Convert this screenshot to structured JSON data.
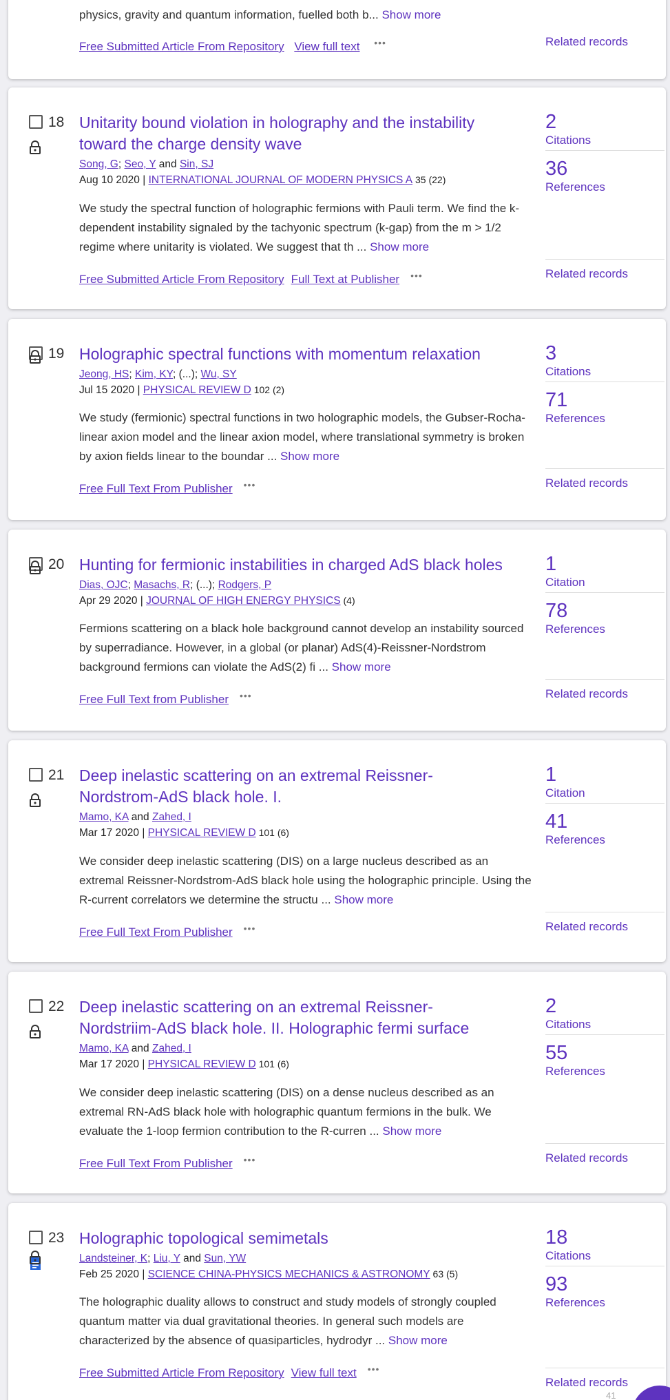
{
  "colors": {
    "accent": "#5e33bf",
    "background": "#efeff3",
    "card": "#ffffff"
  },
  "prev": {
    "abstract_tail": "physics, gravity and quantum information, fuelled both b",
    "links": [
      "Free Submitted Article From Repository",
      "View full text"
    ],
    "related": "Related records"
  },
  "common": {
    "ellipsis": "...",
    "show_more": "Show more",
    "related": "Related records",
    "more_icon": "•••"
  },
  "records": [
    {
      "num": "18",
      "title": "Unitarity bound violation in holography and the instability toward the charge density wave",
      "authors": [
        {
          "name": "Song, G",
          "sep": "; "
        },
        {
          "name": "Seo, Y",
          "sep": " and "
        },
        {
          "name": "Sin, SJ",
          "sep": ""
        }
      ],
      "date": "Aug 10 2020 | ",
      "journal": "INTERNATIONAL JOURNAL OF MODERN PHYSICS A",
      "vol": " 35 (22)",
      "abstract": "We study the spectral function of holographic fermions with Pauli term. We find the k-dependent instability signaled by the tachyonic spectrum (k-gap) from the m > 1/2 regime where unitarity is violated. We suggest that th",
      "links": [
        "Free Submitted Article From Repository",
        "Full Text at Publisher"
      ],
      "citations": "2",
      "citations_label": "Citations",
      "references": "36",
      "references_label": "References"
    },
    {
      "num": "19",
      "title": "Holographic spectral functions with momentum relaxation",
      "authors": [
        {
          "name": "Jeong, HS",
          "sep": "; "
        },
        {
          "name": "Kim, KY",
          "sep": "; (...); "
        },
        {
          "name": "Wu, SY",
          "sep": ""
        }
      ],
      "date": "Jul 15 2020 | ",
      "journal": "PHYSICAL REVIEW D",
      "vol": " 102 (2)",
      "abstract": "We study (fermionic) spectral functions in two holographic models, the Gubser-Rocha-linear axion model and the linear axion model, where translational symmetry is broken by axion fields linear to the boundar",
      "links": [
        "Free Full Text From Publisher"
      ],
      "citations": "3",
      "citations_label": "Citations",
      "references": "71",
      "references_label": "References"
    },
    {
      "num": "20",
      "title": "Hunting for fermionic instabilities in charged AdS black holes",
      "authors": [
        {
          "name": "Dias, OJC",
          "sep": "; "
        },
        {
          "name": "Masachs, R",
          "sep": "; (...); "
        },
        {
          "name": "Rodgers, P",
          "sep": ""
        }
      ],
      "date": "Apr 29 2020 | ",
      "journal": "JOURNAL OF HIGH ENERGY PHYSICS",
      "vol": " (4)",
      "abstract": "Fermions scattering on a black hole background cannot develop an instability sourced by superradiance. However, in a global (or planar) AdS(4)-Reissner-Nordstrom background fermions can violate the AdS(2) fi",
      "links": [
        "Free Full Text from Publisher"
      ],
      "citations": "1",
      "citations_label": "Citation",
      "references": "78",
      "references_label": "References"
    },
    {
      "num": "21",
      "title": "Deep inelastic scattering on an extremal Reissner-Nordstrom-AdS black hole. I.",
      "authors": [
        {
          "name": "Mamo, KA",
          "sep": " and "
        },
        {
          "name": "Zahed, I",
          "sep": ""
        }
      ],
      "date": "Mar 17 2020 | ",
      "journal": "PHYSICAL REVIEW D",
      "vol": " 101 (6)",
      "abstract": "We consider deep inelastic scattering (DIS) on a large nucleus described as an extremal Reissner-Nordstrom-AdS black hole using the holographic principle. Using the R-current correlators we determine the structu",
      "links": [
        "Free Full Text From Publisher"
      ],
      "citations": "1",
      "citations_label": "Citation",
      "references": "41",
      "references_label": "References"
    },
    {
      "num": "22",
      "title": "Deep inelastic scattering on an extremal Reissner-Nordstriim-AdS black hole. II. Holographic fermi surface",
      "authors": [
        {
          "name": "Mamo, KA",
          "sep": " and "
        },
        {
          "name": "Zahed, I",
          "sep": ""
        }
      ],
      "date": "Mar 17 2020 | ",
      "journal": "PHYSICAL REVIEW D",
      "vol": " 101 (6)",
      "abstract": "We consider deep inelastic scattering (DIS) on a dense nucleus described as an extremal RN-AdS black hole with holographic quantum fermions in the bulk. We evaluate the 1-loop fermion contribution to the R-curren",
      "links": [
        "Free Full Text From Publisher"
      ],
      "citations": "2",
      "citations_label": "Citations",
      "references": "55",
      "references_label": "References"
    },
    {
      "num": "23",
      "title": "Holographic topological semimetals",
      "authors": [
        {
          "name": "Landsteiner, K",
          "sep": "; "
        },
        {
          "name": "Liu, Y",
          "sep": " and "
        },
        {
          "name": "Sun, YW",
          "sep": ""
        }
      ],
      "date": "Feb 25 2020 | ",
      "journal": "SCIENCE CHINA-PHYSICS MECHANICS & ASTRONOMY",
      "vol": " 63 (5)",
      "abstract": "The holographic duality allows to construct and study models of strongly coupled quantum matter via dual gravitational theories. In general such models are characterized by the absence of quasiparticles, hydrodyr",
      "links": [
        "Free Submitted Article From Repository",
        "View full text"
      ],
      "citations": "18",
      "citations_label": "Citations",
      "references": "93",
      "references_label": "References"
    }
  ],
  "fab_number": "41"
}
